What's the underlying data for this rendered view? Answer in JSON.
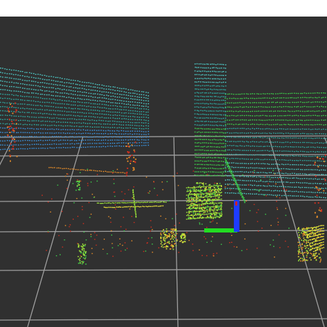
{
  "viewport": {
    "background_color": "#303030",
    "page_color": "#ffffff",
    "grid_color": "#a0a0a0",
    "palette": {
      "blue": "#3a8fd6",
      "teal": "#2fa7a0",
      "cyan": "#4cc3c0",
      "green": "#3cc84a",
      "lime": "#9be03a",
      "yellow": "#e7e03a",
      "orange": "#e08a2a",
      "red": "#cc2f1e"
    },
    "axes": {
      "x_axis_color": "#22dd22",
      "y_axis_color": "#1e3cff",
      "z_axis_color": "#cc2222"
    },
    "objects": [
      "left-wall-point-cloud",
      "right-wall-point-cloud",
      "pillar-point-cloud",
      "chair-point-cloud",
      "box-point-cloud",
      "floor-noise-point-cloud",
      "coordinate-axes-marker"
    ]
  }
}
